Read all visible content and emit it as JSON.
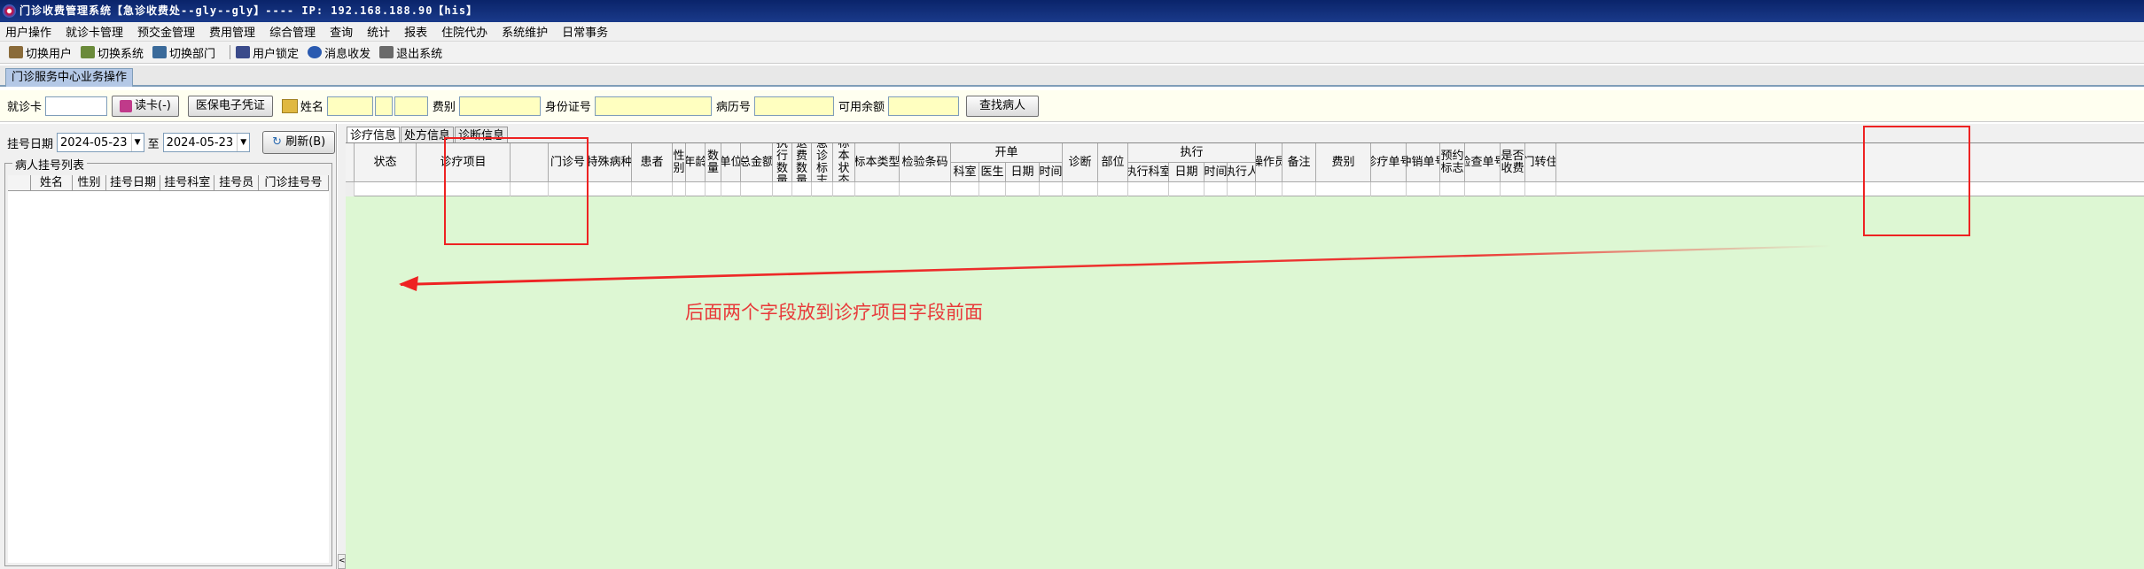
{
  "window": {
    "title": "门诊收费管理系统【急诊收费处--gly--gly】---- IP: 192.168.188.90【his】"
  },
  "menu": [
    "用户操作",
    "就诊卡管理",
    "预交金管理",
    "费用管理",
    "综合管理",
    "查询",
    "统计",
    "报表",
    "住院代办",
    "系统维护",
    "日常事务"
  ],
  "toolbar": [
    {
      "label": "切换用户",
      "icon": "switch-user-icon",
      "color": "#8a6b3a"
    },
    {
      "label": "切换系统",
      "icon": "switch-system-icon",
      "color": "#6a8a3a"
    },
    {
      "label": "切换部门",
      "icon": "switch-department-icon",
      "color": "#3a6a9a"
    },
    {
      "label": "用户锁定",
      "icon": "user-lock-icon",
      "color": "#3a4a8a"
    },
    {
      "label": "消息收发",
      "icon": "message-icon",
      "color": "#2a5ab0"
    },
    {
      "label": "退出系统",
      "icon": "exit-icon",
      "color": "#6a6a6a"
    }
  ],
  "main_tab": "门诊服务中心业务操作",
  "search": {
    "card_label": "就诊卡",
    "read_card": "读卡(-)",
    "insurance_btn": "医保电子凭证",
    "name_label": "姓名",
    "fee_type_label": "费别",
    "id_label": "身份证号",
    "record_label": "病历号",
    "balance_label": "可用余额",
    "find_btn": "查找病人"
  },
  "left": {
    "date_label": "挂号日期",
    "date_from": "2024-05-23",
    "to_label": "至",
    "date_to": "2024-05-23",
    "refresh": "刷新(B)",
    "group_title": "病人挂号列表",
    "columns": [
      "姓名",
      "性别",
      "挂号日期",
      "挂号科室",
      "挂号员",
      "门诊挂号号"
    ]
  },
  "right_tabs": [
    "诊疗信息",
    "处方信息",
    "诊断信息"
  ],
  "grid": {
    "col_status": "状态",
    "col_item": "诊疗项目",
    "col_outpatient": "门诊号",
    "col_disease": "特殊病种",
    "col_patient": "患者",
    "col_sex": "性别",
    "col_age": "年龄",
    "col_qty": "数量",
    "col_unit": "单位",
    "col_total": "总金额",
    "col_exec_qty": "执行数量",
    "col_refund_qty": "退费数量",
    "col_urgent": "急诊标志",
    "col_sample_status": "标本状态",
    "col_sample_type": "标本类型",
    "col_barcode": "检验条码",
    "grp_order": "开单",
    "col_dept": "科室",
    "col_doctor": "医生",
    "col_date": "日期",
    "col_time": "时间",
    "col_diagnosis": "诊断",
    "col_part": "部位",
    "grp_exec": "执行",
    "col_exec_dept": "执行科室",
    "col_exec_date": "日期",
    "col_exec_time": "时间",
    "col_executor": "执行人",
    "col_operator": "操作员",
    "col_note": "备注",
    "col_fee_type": "费别",
    "col_order_no": "诊疗单号",
    "col_reversal_no": "冲销单号",
    "col_booking": "预约标志",
    "col_exam_no": "检查单号",
    "col_charged": "是否收费",
    "col_transfer": "门转住"
  },
  "annotation": "后面两个字段放到诊疗项目字段前面",
  "colors": {
    "annotation": "#e83a3a",
    "grid_bg": "#ddf7d3",
    "title_bg": "#0a246a"
  }
}
